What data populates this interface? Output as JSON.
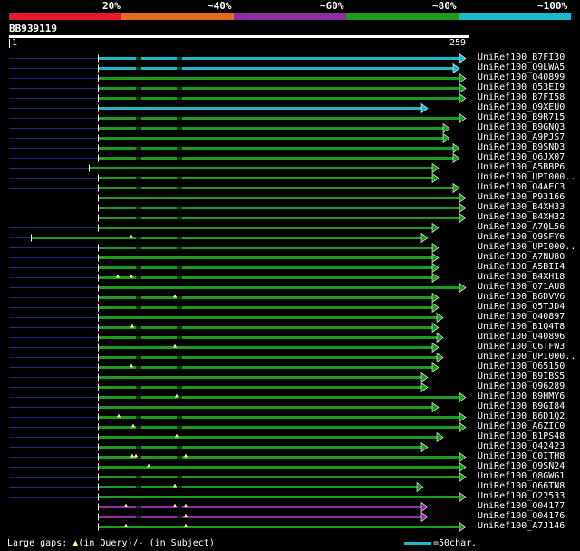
{
  "color_key": {
    "items": [
      {
        "label": "20%",
        "color": "#e8182c"
      },
      {
        "label": "~40%",
        "color": "#e06b1c"
      },
      {
        "label": "~60%",
        "color": "#8e2d9e"
      },
      {
        "label": "~80%",
        "color": "#1e9a1e"
      },
      {
        "label": "~100%",
        "color": "#1fb8c8"
      }
    ]
  },
  "query": {
    "name": "BB939119",
    "start": "1",
    "end": "259"
  },
  "hits": [
    {
      "name": "UniRef100_B7FI30",
      "color": "#1fb8c8"
    },
    {
      "name": "UniRef100_Q9LWA5",
      "color": "#1fb8c8"
    },
    {
      "name": "UniRef100_Q40899",
      "color": "#1e9a1e"
    },
    {
      "name": "UniRef100_Q53EI9",
      "color": "#1e9a1e"
    },
    {
      "name": "UniRef100_B7FI58",
      "color": "#1e9a1e"
    },
    {
      "name": "UniRef100_Q9XEU0",
      "color": "#1fb8c8"
    },
    {
      "name": "UniRef100_B9R715",
      "color": "#1e9a1e"
    },
    {
      "name": "UniRef100_B9GNQ3",
      "color": "#1e9a1e"
    },
    {
      "name": "UniRef100_A9PJS7",
      "color": "#1e9a1e"
    },
    {
      "name": "UniRef100_B9SND3",
      "color": "#1e9a1e"
    },
    {
      "name": "UniRef100_Q6JX07",
      "color": "#1e9a1e"
    },
    {
      "name": "UniRef100_A5BBP6",
      "color": "#1e9a1e"
    },
    {
      "name": "UniRef100_UPI000..",
      "color": "#1e9a1e"
    },
    {
      "name": "UniRef100_Q4AEC3",
      "color": "#1e9a1e"
    },
    {
      "name": "UniRef100_P93166",
      "color": "#1e9a1e"
    },
    {
      "name": "UniRef100_B4XH33",
      "color": "#1e9a1e"
    },
    {
      "name": "UniRef100_B4XH32",
      "color": "#1e9a1e"
    },
    {
      "name": "UniRef100_A7QL56",
      "color": "#1e9a1e"
    },
    {
      "name": "UniRef100_Q9SFY6",
      "color": "#1e9a1e"
    },
    {
      "name": "UniRef100_UPI000..",
      "color": "#1e9a1e"
    },
    {
      "name": "UniRef100_A7NU80",
      "color": "#1e9a1e"
    },
    {
      "name": "UniRef100_A5BII4",
      "color": "#1e9a1e"
    },
    {
      "name": "UniRef100_B4XH18",
      "color": "#1e9a1e"
    },
    {
      "name": "UniRef100_Q71AU8",
      "color": "#1e9a1e"
    },
    {
      "name": "UniRef100_B6DVV6",
      "color": "#1e9a1e"
    },
    {
      "name": "UniRef100_Q5TJD4",
      "color": "#1e9a1e"
    },
    {
      "name": "UniRef100_Q40897",
      "color": "#1e9a1e"
    },
    {
      "name": "UniRef100_B1Q4T8",
      "color": "#1e9a1e"
    },
    {
      "name": "UniRef100_Q40896",
      "color": "#1e9a1e"
    },
    {
      "name": "UniRef100_C6TFW3",
      "color": "#1e9a1e"
    },
    {
      "name": "UniRef100_UPI000..",
      "color": "#1e9a1e"
    },
    {
      "name": "UniRef100_O65150",
      "color": "#1e9a1e"
    },
    {
      "name": "UniRef100_B9IBS5",
      "color": "#1e9a1e"
    },
    {
      "name": "UniRef100_Q96289",
      "color": "#1e9a1e"
    },
    {
      "name": "UniRef100_B9HMY6",
      "color": "#1e9a1e"
    },
    {
      "name": "UniRef100_B9GI84",
      "color": "#1e9a1e"
    },
    {
      "name": "UniRef100_B6D1Q2",
      "color": "#1e9a1e"
    },
    {
      "name": "UniRef100_A6ZIC0",
      "color": "#1e9a1e"
    },
    {
      "name": "UniRef100_B1PS48",
      "color": "#1e9a1e"
    },
    {
      "name": "UniRef100_Q42423",
      "color": "#1e9a1e"
    },
    {
      "name": "UniRef100_C0ITH8",
      "color": "#1e9a1e"
    },
    {
      "name": "UniRef100_Q9SN24",
      "color": "#1e9a1e"
    },
    {
      "name": "UniRef100_Q8GWG1",
      "color": "#1e9a1e"
    },
    {
      "name": "UniRef100_Q66TN8",
      "color": "#1e9a1e"
    },
    {
      "name": "UniRef100_O22533",
      "color": "#1e9a1e"
    },
    {
      "name": "UniRef100_O04177",
      "color": "#8e2d9e"
    },
    {
      "name": "UniRef100_O04176",
      "color": "#8e2d9e"
    },
    {
      "name": "UniRef100_A7J146",
      "color": "#1e9a1e"
    }
  ],
  "legend": {
    "large_gaps": "Large gaps:",
    "in_query": "(in Query)/",
    "in_subject": "(in Subject)",
    "scale_text": "=50char."
  }
}
